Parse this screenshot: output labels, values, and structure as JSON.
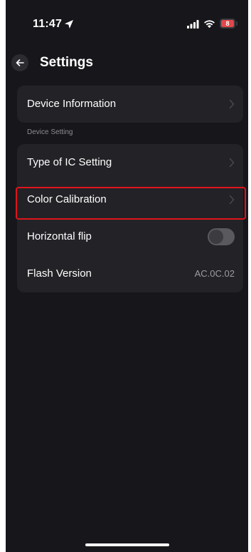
{
  "status_bar": {
    "time": "11:47",
    "battery_level": "8",
    "icons": [
      "location-arrow-icon",
      "signal-icon",
      "wifi-icon",
      "battery-icon"
    ]
  },
  "header": {
    "title": "Settings",
    "back_icon": "arrow-left-icon"
  },
  "device_information": {
    "label": "Device Information"
  },
  "device_setting": {
    "section_label": "Device Setting",
    "rows": [
      {
        "label": "Type of IC Setting",
        "control": "chevron"
      },
      {
        "label": "Color Calibration",
        "control": "chevron",
        "highlighted": true
      },
      {
        "label": "Horizontal flip",
        "control": "toggle",
        "toggle_on": false
      },
      {
        "label": "Flash Version",
        "control": "value",
        "value": "AC.0C.02"
      }
    ]
  },
  "colors": {
    "background": "#17171b",
    "card": "#232327",
    "highlight_border": "#e0141c",
    "battery_fill": "#e0484a",
    "muted_text": "#8b8b91"
  }
}
